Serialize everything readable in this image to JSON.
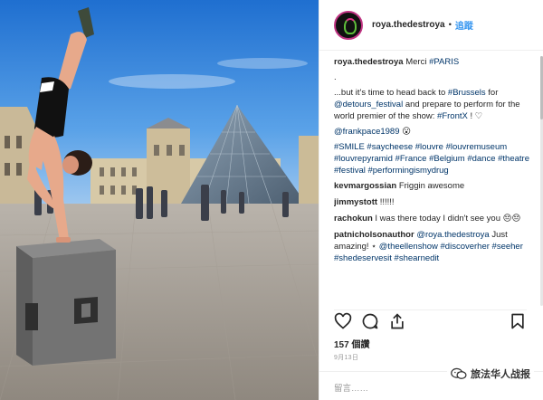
{
  "post": {
    "username": "roya.thedestroya",
    "follow_label": "追蹤",
    "separator": "•"
  },
  "caption": {
    "username": "roya.thedestroya",
    "line1_text": "Merci ",
    "line1_tag": "#PARIS",
    "dot": ".",
    "line2_prefix": "...but it's time to head back to ",
    "tag_brussels": "#Brussels",
    "line2_for": " for ",
    "mention_detours": "@detours_festival",
    "line2_mid": " and prepare to perform for the world premier of the show: ",
    "tag_frontx": "#FrontX",
    "line2_end": " ! ♡",
    "mention_frank": "@frankpace1989",
    "frank_emoji": " 😮",
    "hashtags": "#SMILE #saycheese #louvre #louvremuseum #louvrepyramid #France #Belgium #dance #theatre #festival #performingismydrug"
  },
  "comments": [
    {
      "user": "kevmargossian",
      "text": "Friggin awesome"
    },
    {
      "user": "jimmystott",
      "text": "!!!!!!"
    },
    {
      "user": "rachokun",
      "text": "I was there today I didn't see you 😔😔"
    },
    {
      "user": "patnicholsonauthor",
      "mention": "@roya.thedestroya",
      "text": " Just amazing! ⋆ ",
      "tags": "@theellenshow #discoverher #seeher #shedeservesit #shearnedit"
    }
  ],
  "likes": "157 個讚",
  "date": "9月13日",
  "comment_placeholder": "留言……",
  "watermark": "旅法华人战报",
  "icons": {
    "like": "heart-icon",
    "comment": "comment-icon",
    "share": "share-icon",
    "save": "bookmark-icon"
  },
  "colors": {
    "link": "#3897f0",
    "tag": "#003569",
    "sky": "#2f7fd9"
  }
}
